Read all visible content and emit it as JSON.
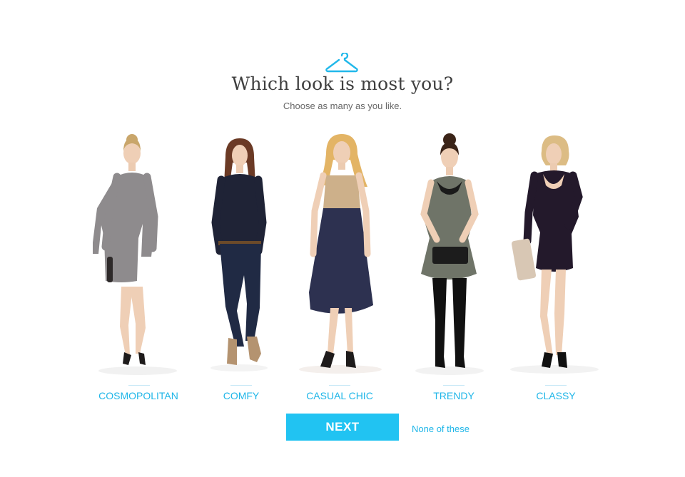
{
  "header": {
    "icon": "hanger-icon",
    "title": "Which look is most you?",
    "subtitle": "Choose as many as you like."
  },
  "looks": [
    {
      "label": "COSMOPOLITAN"
    },
    {
      "label": "COMFY"
    },
    {
      "label": "CASUAL CHIC"
    },
    {
      "label": "TRENDY"
    },
    {
      "label": "CLASSY"
    }
  ],
  "actions": {
    "next_label": "NEXT",
    "none_label": "None of these"
  },
  "colors": {
    "accent": "#21c3f2",
    "link": "#1fb6e8",
    "title": "#3f3f3f"
  }
}
